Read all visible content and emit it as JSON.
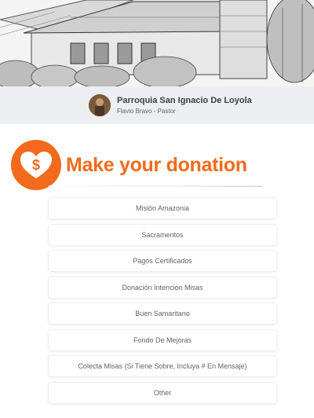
{
  "header": {
    "org_name": "Parroquia San Ignacio De Loyola",
    "subtitle": "Flavio Bravo - Pastor",
    "hero_image": "church-sketch",
    "avatar_image": "pastor-photo"
  },
  "donation": {
    "icon": "heart-dollar-icon",
    "title": "Make your donation",
    "accent_color": "#f26a1b",
    "options": [
      {
        "label": "Misión Amazonia"
      },
      {
        "label": "Sacramentos"
      },
      {
        "label": "Pagos Certificados"
      },
      {
        "label": "Donación Intención Misas"
      },
      {
        "label": "Buen Samaritano"
      },
      {
        "label": "Fondo De Mejoras"
      },
      {
        "label": "Colecta Misas (Si Tiene Sobre, Incluya # En Mensaje)"
      },
      {
        "label": "Other"
      }
    ]
  }
}
